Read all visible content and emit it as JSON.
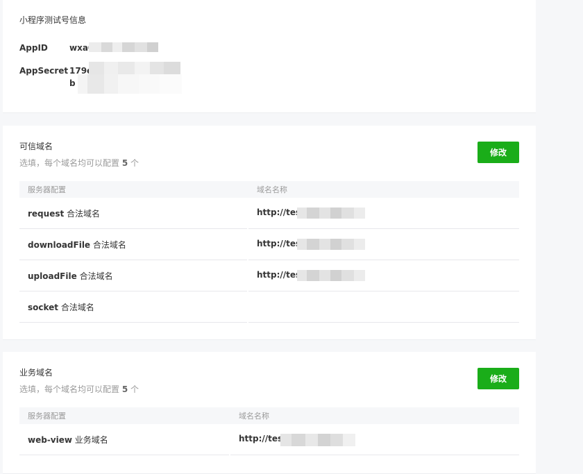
{
  "info": {
    "title": "小程序测试号信息",
    "appid_label": "AppID",
    "appid_value": "wxa0",
    "secret_label": "AppSecret",
    "secret_value": "179e",
    "secret_value_line2": "b"
  },
  "trusted": {
    "title": "可信域名",
    "desc_prefix": "选填，每个域名均可以配置",
    "desc_count": "5",
    "desc_suffix": "个",
    "edit_label": "修改",
    "col1": "服务器配置",
    "col2": "域名名称",
    "rows": [
      {
        "api": "request",
        "suffix": "合法域名",
        "domain": "http://test"
      },
      {
        "api": "downloadFile",
        "suffix": "合法域名",
        "domain": "http://test"
      },
      {
        "api": "uploadFile",
        "suffix": "合法域名",
        "domain": "http://test"
      },
      {
        "api": "socket",
        "suffix": "合法域名",
        "domain": ""
      }
    ]
  },
  "business": {
    "title": "业务域名",
    "desc_prefix": "选填，每个域名均可以配置",
    "desc_count": "5",
    "desc_suffix": "个",
    "edit_label": "修改",
    "col1": "服务器配置",
    "col2": "域名名称",
    "rows": [
      {
        "api": "web-view",
        "suffix": "业务域名",
        "domain": "http://test"
      }
    ]
  },
  "colors": {
    "accent": "#1aad19",
    "background": "#f6f7f9",
    "muted_text": "#9a9a9a"
  }
}
